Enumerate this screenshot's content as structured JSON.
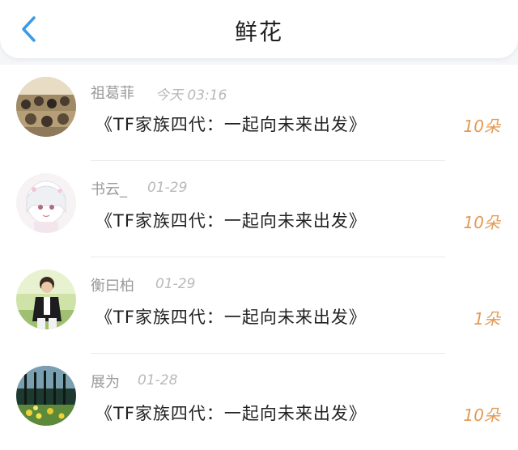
{
  "header": {
    "title": "鲜花",
    "back_icon": "chevron-left-icon",
    "accent_color": "#3a9be8"
  },
  "gifts": [
    {
      "user": "祖葛菲",
      "time": "今天 03:16",
      "message": "《TF家族四代：一起向未来出发》",
      "count": "10朵",
      "avatar_icon": "crowd-photo-avatar"
    },
    {
      "user": "书云_",
      "time": "01-29",
      "message": "《TF家族四代：一起向未来出发》",
      "count": "10朵",
      "avatar_icon": "anime-girl-avatar"
    },
    {
      "user": "衡曰柏",
      "time": "01-29",
      "message": "《TF家族四代：一起向未来出发》",
      "count": "1朵",
      "avatar_icon": "boy-photo-avatar"
    },
    {
      "user": "展为",
      "time": "01-28",
      "message": "《TF家族四代：一起向未来出发》",
      "count": "10朵",
      "avatar_icon": "garden-photo-avatar"
    }
  ]
}
